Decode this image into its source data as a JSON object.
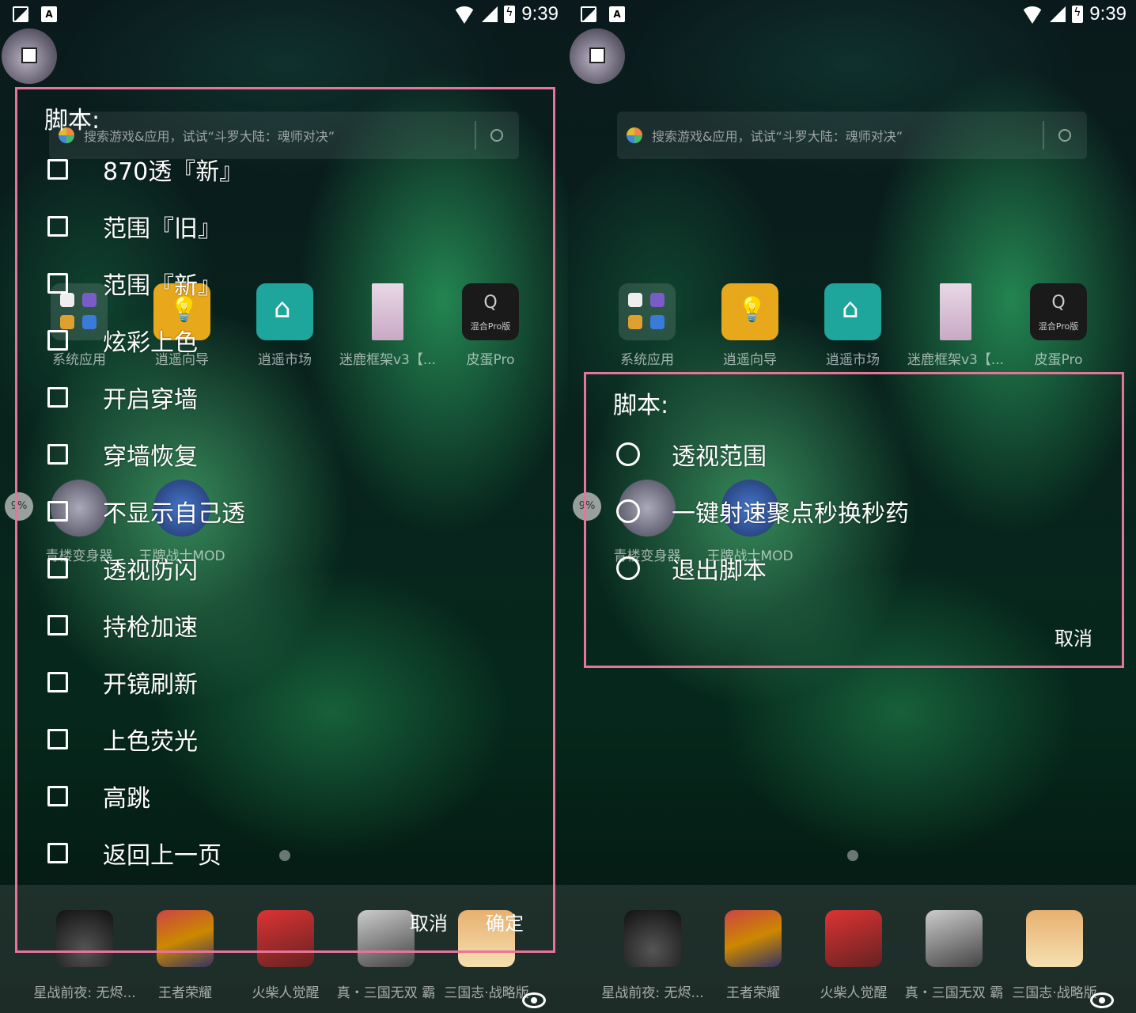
{
  "status": {
    "time": "9:39",
    "notif_a": "A"
  },
  "search": {
    "placeholder": "搜索游戏&应用，试试“斗罗大陆：魂师对决”"
  },
  "apps": [
    {
      "label": "系统应用"
    },
    {
      "label": "逍遥向导"
    },
    {
      "label": "逍遥市场"
    },
    {
      "label": "迷鹿框架v3【..."
    },
    {
      "label": "皮蛋Pro"
    }
  ],
  "pidan_icon": {
    "glyph": "Q",
    "sub": "混合Pro版"
  },
  "apps_row2": [
    {
      "label": "青楼变身器"
    },
    {
      "label": "王牌战士MOD"
    }
  ],
  "progress_badge": "9%",
  "dock": [
    {
      "label": "星战前夜: 无烬..."
    },
    {
      "label": "王者荣耀"
    },
    {
      "label": "火柴人觉醒"
    },
    {
      "label": "真・三国无双 霸"
    },
    {
      "label": "三国志·战略版"
    }
  ],
  "left_dialog": {
    "title": "脚本:",
    "options": [
      "870透『新』",
      "范围『旧』",
      "范围『新』",
      "炫彩上色",
      "开启穿墙",
      "穿墙恢复",
      "不显示自己透",
      "透视防闪",
      "持枪加速",
      "开镜刷新",
      "上色荧光",
      "高跳",
      "返回上一页"
    ],
    "cancel": "取消",
    "confirm": "确定"
  },
  "right_dialog": {
    "title": "脚本:",
    "options": [
      "透视范围",
      "一键射速聚点秒换秒药",
      "退出脚本"
    ],
    "cancel": "取消"
  },
  "colors": {
    "dialog_border": "#e8749a",
    "overlay_bg": "#0a2a1e"
  }
}
